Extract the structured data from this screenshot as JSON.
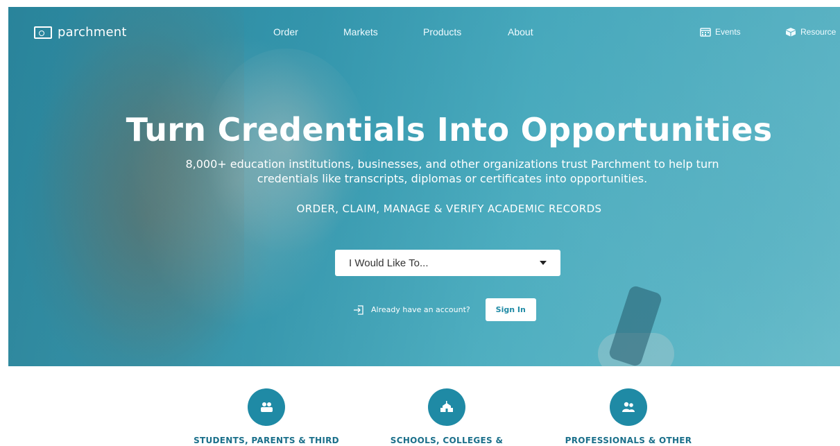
{
  "brand": {
    "logo_text": "parchment"
  },
  "nav": {
    "links": [
      "Order",
      "Markets",
      "Products",
      "About"
    ],
    "events_label": "Events",
    "resources_label": "Resource"
  },
  "hero": {
    "title": "Turn Credentials Into Opportunities",
    "subtitle": "8,000+ education institutions, businesses, and other organizations trust Parchment to help turn credentials like transcripts, diplomas or certificates into opportunities.",
    "tagline": "ORDER, CLAIM, MANAGE & VERIFY ACADEMIC RECORDS",
    "dropdown_label": "I Would Like To...",
    "account_prompt": "Already have an account?",
    "signin_label": "Sign In"
  },
  "audiences": [
    {
      "label": "STUDENTS, PARENTS & THIRD",
      "icon": "students-icon"
    },
    {
      "label": "SCHOOLS, COLLEGES &",
      "icon": "school-building-icon"
    },
    {
      "label": "PROFESSIONALS & OTHER",
      "icon": "professionals-icon"
    }
  ],
  "colors": {
    "accent": "#1f8aa5",
    "audience_label": "#1a6f8a",
    "hero_tint": "#3f9ab0"
  }
}
